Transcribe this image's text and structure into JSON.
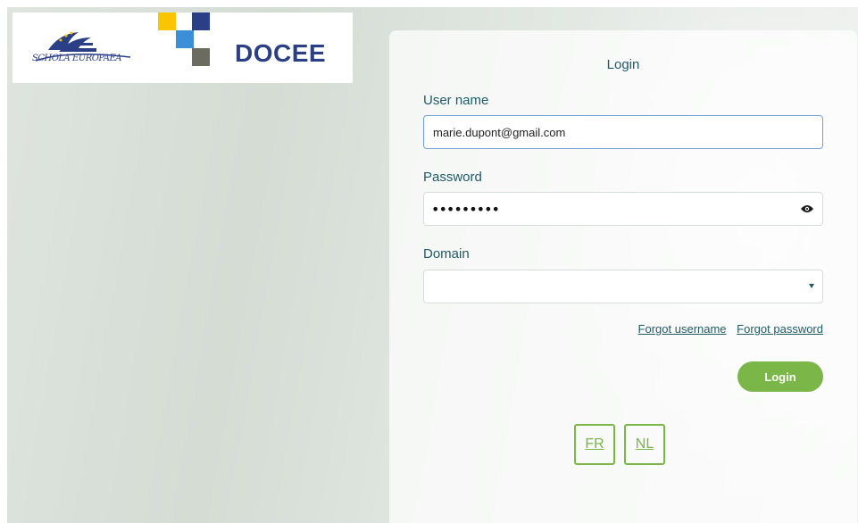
{
  "logos": {
    "school_logo_text": "SCHOLA EUROPAEA",
    "brand_text": "DOCEE"
  },
  "login": {
    "title": "Login",
    "username_label": "User name",
    "username_value": "marie.dupont@gmail.com",
    "password_label": "Password",
    "password_mask": "•••••••••",
    "domain_label": "Domain",
    "domain_value": "",
    "forgot_username": "Forgot username",
    "forgot_password": "Forgot password",
    "submit_label": "Login"
  },
  "languages": [
    "FR",
    "NL"
  ],
  "colors": {
    "accent_green": "#7ab648",
    "text_teal": "#1f5a66",
    "brand_blue": "#2a3f85"
  }
}
